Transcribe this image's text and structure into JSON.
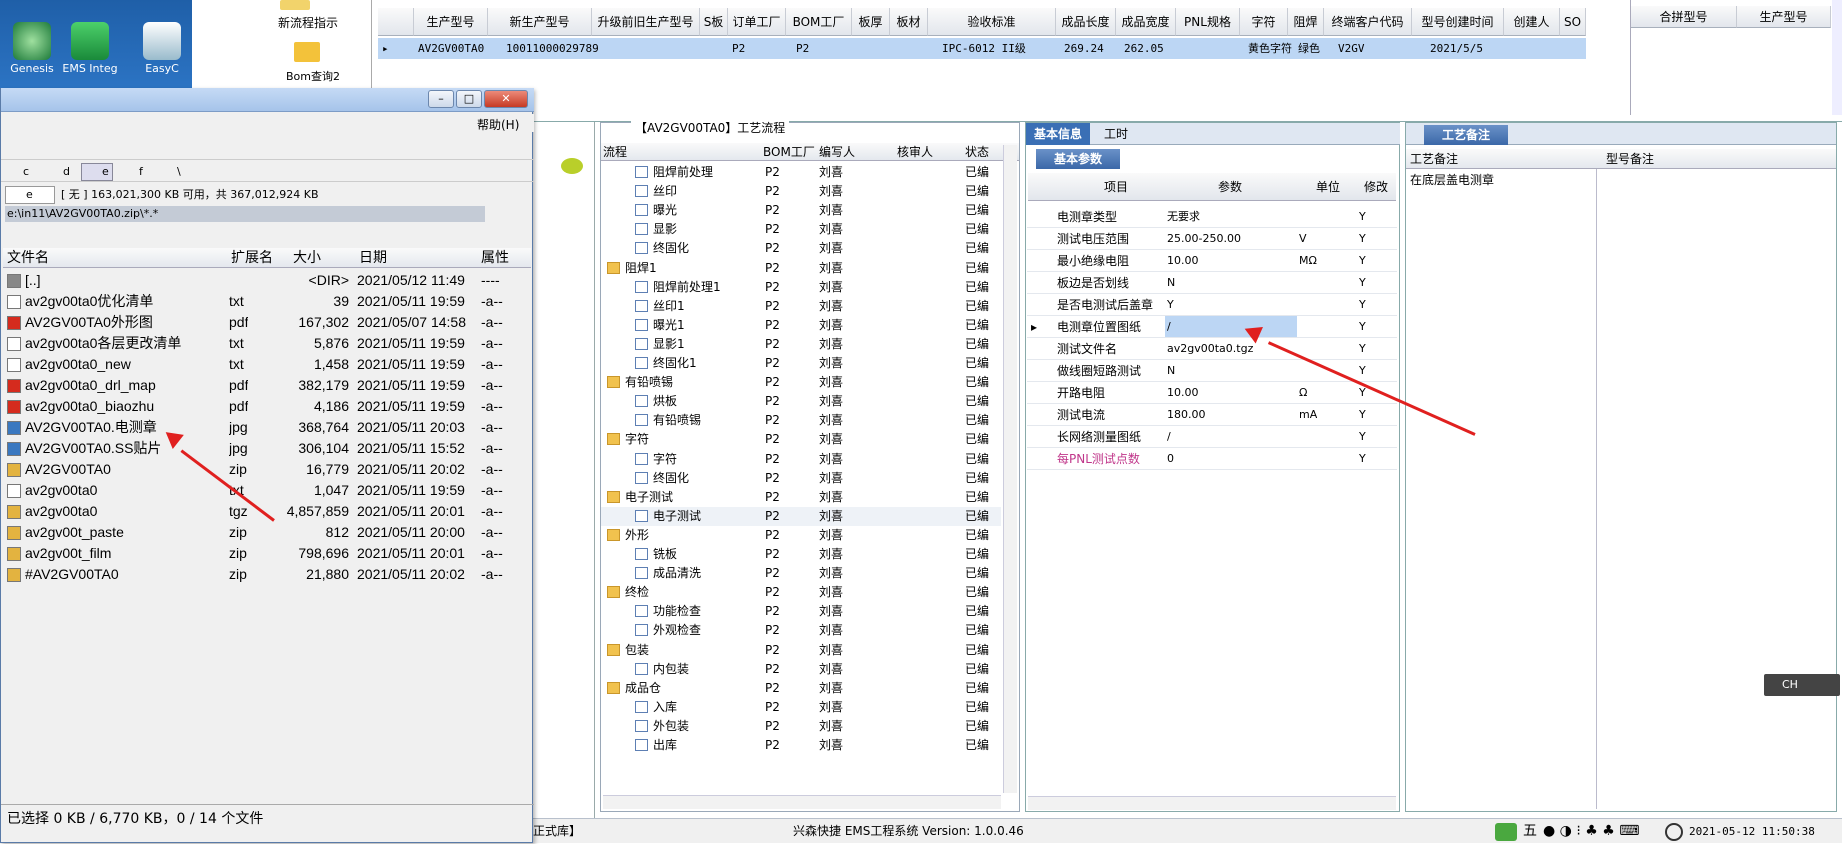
{
  "desktop": {
    "icons": [
      {
        "label": "Genesis"
      },
      {
        "label": "EMS Integ"
      },
      {
        "label": "EasyC"
      }
    ]
  },
  "launcher": {
    "item1": "新流程指示",
    "item2": "Bom查询2"
  },
  "top_grid": {
    "columns": [
      "生产型号",
      "新生产型号",
      "升级前旧生产型号",
      "S板",
      "订单工厂",
      "BOM工厂",
      "板厚",
      "板材",
      "验收标准",
      "成品长度",
      "成品宽度",
      "PNL规格",
      "字符",
      "阻焊",
      "终端客户代码",
      "型号创建时间",
      "创建人",
      "SO"
    ],
    "row": [
      "AV2GV00TA0",
      "10011000029789",
      "",
      "",
      "P2",
      "P2",
      "",
      "",
      "IPC-6012 II级",
      "269.24",
      "262.05",
      "",
      "黄色字符",
      "绿色",
      "V2GV",
      "2021/5/5",
      "",
      ""
    ],
    "right_columns": [
      "合拼型号",
      "生产型号"
    ]
  },
  "explorer": {
    "help_menu": "帮助(H)",
    "drives": [
      "c",
      "d",
      "e",
      "f",
      "\\"
    ],
    "drive_select": "e",
    "free_space": "[ 无 ]  163,021,300 KB 可用，共 367,012,924 KB",
    "path": "e:\\in11\\AV2GV00TA0.zip\\*.*",
    "columns": [
      "文件名",
      "扩展名",
      "大小",
      "日期",
      "属性"
    ],
    "files": [
      {
        "name": "[..]",
        "ext": "",
        "size": "<DIR>",
        "date": "2021/05/12 11:49",
        "attr": "----"
      },
      {
        "name": "av2gv00ta0优化清单",
        "ext": "txt",
        "size": "39",
        "date": "2021/05/11 19:59",
        "attr": "-a--"
      },
      {
        "name": "AV2GV00TA0外形图",
        "ext": "pdf",
        "size": "167,302",
        "date": "2021/05/07 14:58",
        "attr": "-a--"
      },
      {
        "name": "av2gv00ta0各层更改清单",
        "ext": "txt",
        "size": "5,876",
        "date": "2021/05/11 19:59",
        "attr": "-a--"
      },
      {
        "name": "av2gv00ta0_new",
        "ext": "txt",
        "size": "1,458",
        "date": "2021/05/11 19:59",
        "attr": "-a--"
      },
      {
        "name": "av2gv00ta0_drl_map",
        "ext": "pdf",
        "size": "382,179",
        "date": "2021/05/11 19:59",
        "attr": "-a--"
      },
      {
        "name": "av2gv00ta0_biaozhu",
        "ext": "pdf",
        "size": "4,186",
        "date": "2021/05/11 19:59",
        "attr": "-a--"
      },
      {
        "name": "AV2GV00TA0.电测章",
        "ext": "jpg",
        "size": "368,764",
        "date": "2021/05/11 20:03",
        "attr": "-a--"
      },
      {
        "name": "AV2GV00TA0.SS贴片",
        "ext": "jpg",
        "size": "306,104",
        "date": "2021/05/11 15:52",
        "attr": "-a--"
      },
      {
        "name": "AV2GV00TA0",
        "ext": "zip",
        "size": "16,779",
        "date": "2021/05/11 20:02",
        "attr": "-a--"
      },
      {
        "name": "av2gv00ta0",
        "ext": "txt",
        "size": "1,047",
        "date": "2021/05/11 19:59",
        "attr": "-a--"
      },
      {
        "name": "av2gv00ta0",
        "ext": "tgz",
        "size": "4,857,859",
        "date": "2021/05/11 20:01",
        "attr": "-a--"
      },
      {
        "name": "av2gv00t_paste",
        "ext": "zip",
        "size": "812",
        "date": "2021/05/11 20:00",
        "attr": "-a--"
      },
      {
        "name": "av2gv00t_film",
        "ext": "zip",
        "size": "798,696",
        "date": "2021/05/11 20:01",
        "attr": "-a--"
      },
      {
        "name": "#AV2GV00TA0",
        "ext": "zip",
        "size": "21,880",
        "date": "2021/05/11 20:02",
        "attr": "-a--"
      }
    ],
    "status": "已选择 0 KB / 6,770 KB，0 / 14 个文件"
  },
  "flow": {
    "title": "【AV2GV00TA0】工艺流程",
    "columns": [
      "流程",
      "BOM工厂",
      "编写人",
      "核审人",
      "状态"
    ],
    "rows": [
      {
        "level": 2,
        "name": "阻焊前处理",
        "bom": "P2",
        "author": "刘喜",
        "status": "已编"
      },
      {
        "level": 2,
        "name": "丝印",
        "bom": "P2",
        "author": "刘喜",
        "status": "已编"
      },
      {
        "level": 2,
        "name": "曝光",
        "bom": "P2",
        "author": "刘喜",
        "status": "已编"
      },
      {
        "level": 2,
        "name": "显影",
        "bom": "P2",
        "author": "刘喜",
        "status": "已编"
      },
      {
        "level": 2,
        "name": "终固化",
        "bom": "P2",
        "author": "刘喜",
        "status": "已编"
      },
      {
        "level": 1,
        "name": "阻焊1",
        "bom": "P2",
        "author": "刘喜",
        "status": "已编"
      },
      {
        "level": 2,
        "name": "阻焊前处理1",
        "bom": "P2",
        "author": "刘喜",
        "status": "已编"
      },
      {
        "level": 2,
        "name": "丝印1",
        "bom": "P2",
        "author": "刘喜",
        "status": "已编"
      },
      {
        "level": 2,
        "name": "曝光1",
        "bom": "P2",
        "author": "刘喜",
        "status": "已编"
      },
      {
        "level": 2,
        "name": "显影1",
        "bom": "P2",
        "author": "刘喜",
        "status": "已编"
      },
      {
        "level": 2,
        "name": "终固化1",
        "bom": "P2",
        "author": "刘喜",
        "status": "已编"
      },
      {
        "level": 1,
        "name": "有铅喷锡",
        "bom": "P2",
        "author": "刘喜",
        "status": "已编"
      },
      {
        "level": 2,
        "name": "烘板",
        "bom": "P2",
        "author": "刘喜",
        "status": "已编"
      },
      {
        "level": 2,
        "name": "有铅喷锡",
        "bom": "P2",
        "author": "刘喜",
        "status": "已编"
      },
      {
        "level": 1,
        "name": "字符",
        "bom": "P2",
        "author": "刘喜",
        "status": "已编"
      },
      {
        "level": 2,
        "name": "字符",
        "bom": "P2",
        "author": "刘喜",
        "status": "已编"
      },
      {
        "level": 2,
        "name": "终固化",
        "bom": "P2",
        "author": "刘喜",
        "status": "已编"
      },
      {
        "level": 1,
        "name": "电子测试",
        "bom": "P2",
        "author": "刘喜",
        "status": "已编"
      },
      {
        "level": 2,
        "name": "电子测试",
        "bom": "P2",
        "author": "刘喜",
        "status": "已编"
      },
      {
        "level": 1,
        "name": "外形",
        "bom": "P2",
        "author": "刘喜",
        "status": "已编"
      },
      {
        "level": 2,
        "name": "铣板",
        "bom": "P2",
        "author": "刘喜",
        "status": "已编"
      },
      {
        "level": 2,
        "name": "成品清洗",
        "bom": "P2",
        "author": "刘喜",
        "status": "已编"
      },
      {
        "level": 1,
        "name": "终检",
        "bom": "P2",
        "author": "刘喜",
        "status": "已编"
      },
      {
        "level": 2,
        "name": "功能检查",
        "bom": "P2",
        "author": "刘喜",
        "status": "已编"
      },
      {
        "level": 2,
        "name": "外观检查",
        "bom": "P2",
        "author": "刘喜",
        "status": "已编"
      },
      {
        "level": 1,
        "name": "包装",
        "bom": "P2",
        "author": "刘喜",
        "status": "已编"
      },
      {
        "level": 2,
        "name": "内包装",
        "bom": "P2",
        "author": "刘喜",
        "status": "已编"
      },
      {
        "level": 1,
        "name": "成品仓",
        "bom": "P2",
        "author": "刘喜",
        "status": "已编"
      },
      {
        "level": 2,
        "name": "入库",
        "bom": "P2",
        "author": "刘喜",
        "status": "已编"
      },
      {
        "level": 2,
        "name": "外包装",
        "bom": "P2",
        "author": "刘喜",
        "status": "已编"
      },
      {
        "level": 2,
        "name": "出库",
        "bom": "P2",
        "author": "刘喜",
        "status": "已编"
      }
    ]
  },
  "detail": {
    "tabs": [
      "基本信息",
      "工时"
    ],
    "subtab": "基本参数",
    "columns": [
      "项目",
      "参数",
      "单位",
      "修改"
    ],
    "rows": [
      {
        "item": "电测章类型",
        "param": "无要求",
        "unit": "",
        "mod": "Y"
      },
      {
        "item": "测试电压范围",
        "param": "25.00-250.00",
        "unit": "V",
        "mod": "Y"
      },
      {
        "item": "最小绝缘电阻",
        "param": "10.00",
        "unit": "MΩ",
        "mod": "Y"
      },
      {
        "item": "板边是否划线",
        "param": "N",
        "unit": "",
        "mod": "Y"
      },
      {
        "item": "是否电测试后盖章",
        "param": "Y",
        "unit": "",
        "mod": "Y"
      },
      {
        "item": "电测章位置图纸",
        "param": "/",
        "unit": "",
        "mod": "Y"
      },
      {
        "item": "测试文件名",
        "param": "av2gv00ta0.tgz",
        "unit": "",
        "mod": "Y"
      },
      {
        "item": "做线圈短路测试",
        "param": "N",
        "unit": "",
        "mod": "Y"
      },
      {
        "item": "开路电阻",
        "param": "10.00",
        "unit": "Ω",
        "mod": "Y"
      },
      {
        "item": "测试电流",
        "param": "180.00",
        "unit": "mA",
        "mod": "Y"
      },
      {
        "item": "长网络测量图纸",
        "param": "/",
        "unit": "",
        "mod": "Y"
      },
      {
        "item": "每PNL测试点数",
        "param": "0",
        "unit": "",
        "mod": "Y"
      }
    ]
  },
  "remark": {
    "header": "工艺备注",
    "columns": [
      "工艺备注",
      "型号备注"
    ],
    "text": "在底层盖电测章"
  },
  "statusbar": {
    "left": "正式库】",
    "center": "兴森快捷 EMS工程系统 Version: 1.0.0.46",
    "ime": "五",
    "datetime": "2021-05-12 11:50:38",
    "lang": "CH"
  },
  "colors": {
    "selected_row": "#bcd6f4",
    "arrow": "#e0201f",
    "tab_active": "#3a6fb5"
  }
}
